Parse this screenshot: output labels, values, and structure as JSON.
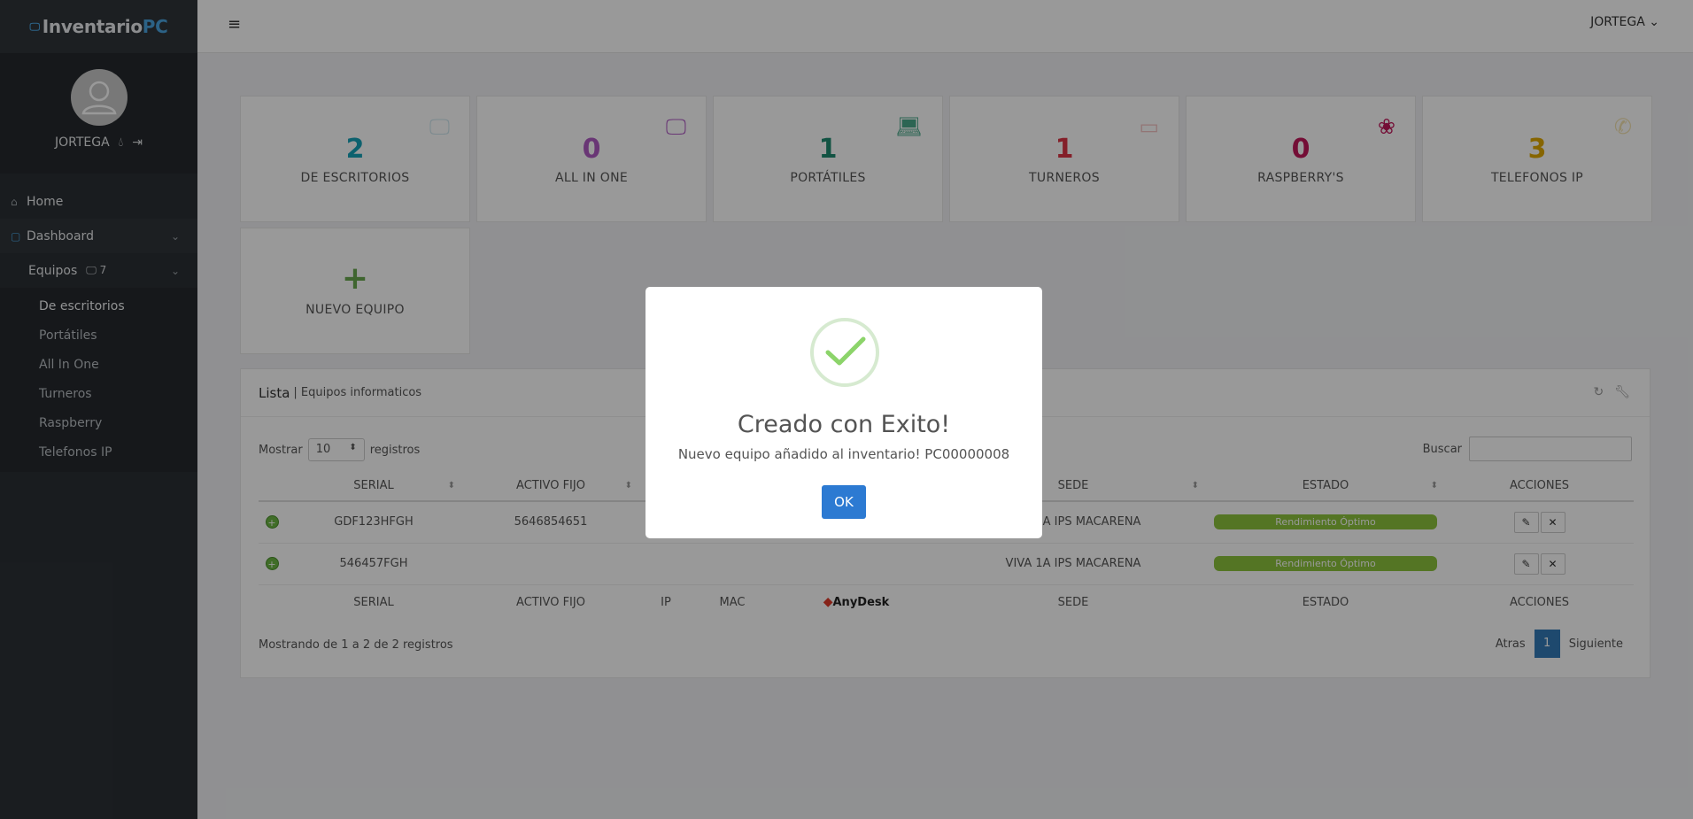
{
  "brand": {
    "name_a": "Inventario",
    "name_b": "PC",
    "icon": "monitor-icon"
  },
  "user": {
    "name": "JORTEGA",
    "avatar": "user-avatar-icon"
  },
  "nav": {
    "home": "Home",
    "dashboard": "Dashboard",
    "equipos": "Equipos",
    "equipos_count": "7",
    "sub": [
      "De escritorios",
      "Portátiles",
      "All In One",
      "Turneros",
      "Raspberry",
      "Telefonos IP"
    ]
  },
  "header": {
    "user_menu": "JORTEGA"
  },
  "cards": [
    {
      "value": "2",
      "label": "DE ESCRITORIOS",
      "color": "#17a2b8",
      "icon": "desktop-icon"
    },
    {
      "value": "0",
      "label": "ALL IN ONE",
      "color": "#b05bc4",
      "icon": "all-in-one-icon"
    },
    {
      "value": "1",
      "label": "PORTÁTILES",
      "color": "#1f8a70",
      "icon": "laptop-icon"
    },
    {
      "value": "1",
      "label": "TURNEROS",
      "color": "#dc3545",
      "icon": "ticket-icon"
    },
    {
      "value": "0",
      "label": "RASPBERRY'S",
      "color": "#c2185b",
      "icon": "raspberry-icon"
    },
    {
      "value": "3",
      "label": "TELEFONOS IP",
      "color": "#e0a800",
      "icon": "phone-icon"
    }
  ],
  "new_card": {
    "icon": "+",
    "label": "NUEVO EQUIPO",
    "color": "#6aa84f"
  },
  "panel": {
    "title": "Lista",
    "subtitle": "| Equipos informaticos",
    "show_label": "Mostrar",
    "show_value": "10",
    "show_suffix": "registros",
    "search_label": "Buscar",
    "columns": [
      "SERIAL",
      "ACTIVO FIJO",
      "SEDE",
      "ESTADO",
      "ACCIONES"
    ],
    "footer_columns": [
      "SERIAL",
      "ACTIVO FIJO",
      "IP",
      "MAC",
      "AnyDesk",
      "SEDE",
      "ESTADO",
      "ACCIONES"
    ],
    "rows": [
      {
        "serial": "GDF123HFGH",
        "activo": "5646854651",
        "sede": "VIVA 1A IPS MACARENA",
        "estado": "Rendimiento Óptimo"
      },
      {
        "serial": "546457FGH",
        "activo": "",
        "sede": "VIVA 1A IPS MACARENA",
        "estado": "Rendimiento Óptimo"
      }
    ],
    "info": "Mostrando de 1 a 2 de 2 registros",
    "prev": "Atras",
    "page": "1",
    "next": "Siguiente"
  },
  "modal": {
    "title": "Creado con Exito!",
    "text": "Nuevo equipo añadido al inventario! PC00000008",
    "ok": "OK"
  }
}
